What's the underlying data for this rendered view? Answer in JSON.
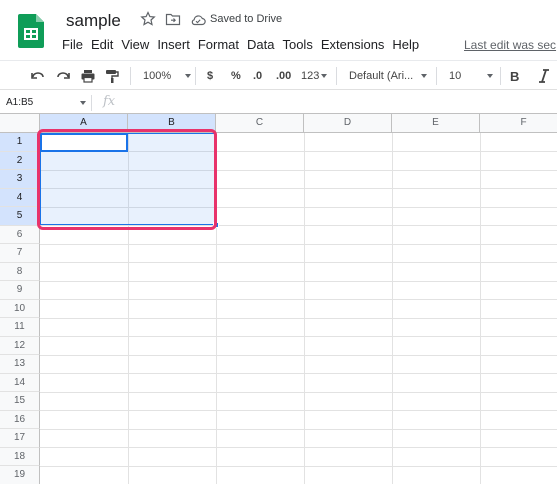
{
  "app": {
    "doc_title": "sample",
    "saved_status": "Saved to Drive",
    "last_edit": "Last edit was sec",
    "brand_color": "#0f9d58",
    "icons": [
      "sheets-logo-icon",
      "star-icon",
      "move-folder-icon",
      "cloud-saved-icon"
    ]
  },
  "menu": {
    "items": [
      "File",
      "Edit",
      "View",
      "Insert",
      "Format",
      "Data",
      "Tools",
      "Extensions",
      "Help"
    ]
  },
  "toolbar": {
    "zoom": "100%",
    "currency": "$",
    "percent": "%",
    "decrease_decimals": ".0",
    "increase_decimals": ".00",
    "more_formats": "123",
    "font": "Default (Ari...",
    "font_size": "10",
    "bold": "B",
    "icons": [
      "undo-icon",
      "redo-icon",
      "print-icon",
      "paint-format-icon",
      "italic-icon"
    ]
  },
  "formula_bar": {
    "name_box": "A1:B5",
    "fx": "fx",
    "value": ""
  },
  "grid": {
    "columns": [
      "A",
      "B",
      "C",
      "D",
      "E",
      "F"
    ],
    "rows": [
      "1",
      "2",
      "3",
      "4",
      "5",
      "6",
      "7",
      "8",
      "9",
      "10",
      "11",
      "12",
      "13",
      "14",
      "15",
      "16",
      "17",
      "18",
      "19"
    ],
    "selection": "A1:B5",
    "selection_color": "#1a73e8",
    "highlight_color": "#e8336b"
  }
}
